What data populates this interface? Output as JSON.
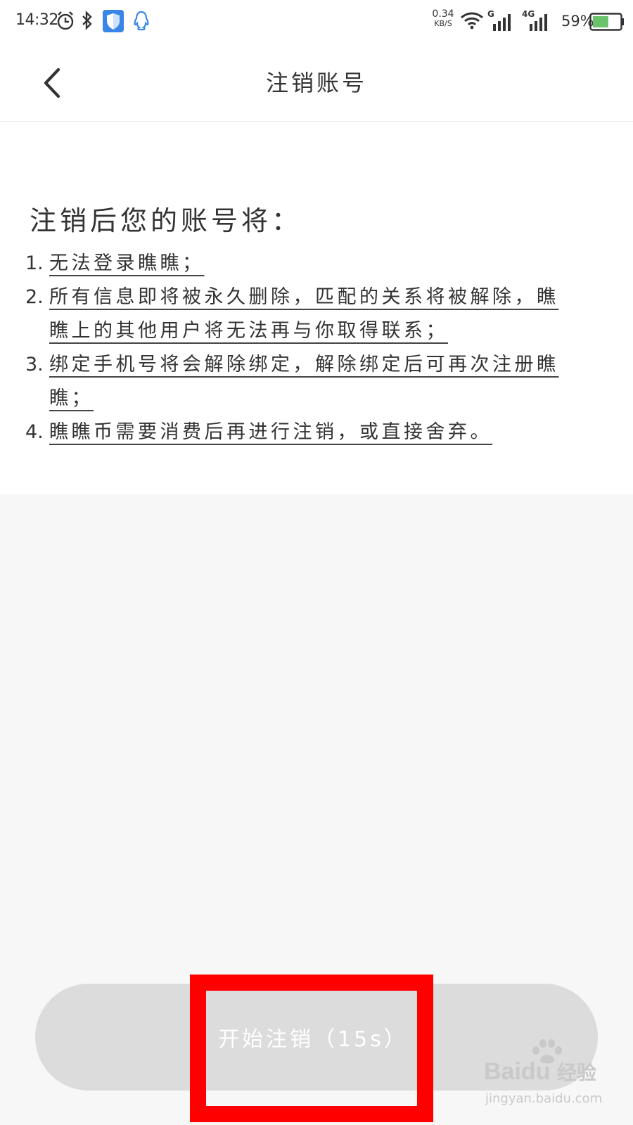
{
  "status_bar": {
    "time": "14:32",
    "net_speed_value": "0.34",
    "net_speed_unit": "KB/S",
    "signal_1_label": "G",
    "signal_2_label": "4G",
    "battery_pct": "59%",
    "icons": [
      "alarm-icon",
      "bluetooth-icon",
      "shield-icon",
      "qq-icon",
      "wifi-icon",
      "signal-icon",
      "battery-icon"
    ]
  },
  "header": {
    "title": "注销账号"
  },
  "content": {
    "heading": "注销后您的账号将：",
    "items": [
      {
        "num": "1.",
        "text": "无法登录瞧瞧；"
      },
      {
        "num": "2.",
        "text": "所有信息即将被永久删除，匹配的关系将被解除，瞧瞧上的其他用户将无法再与你取得联系；"
      },
      {
        "num": "3.",
        "text": "绑定手机号将会解除绑定，解除绑定后可再次注册瞧瞧；"
      },
      {
        "num": "4.",
        "text": "瞧瞧币需要消费后再进行注销，或直接舍弃。"
      }
    ]
  },
  "action": {
    "button_label": "开始注销（15s）"
  },
  "colors": {
    "button_bg": "#dcdcdc",
    "highlight": "#ff0000",
    "battery_fill": "#6ac26a",
    "shield_bg": "#3a86e8",
    "watermark": "#c9c9c9"
  },
  "watermark": {
    "brand_left": "Bai",
    "brand_right": "du",
    "brand_cn": "经验",
    "url": "jingyan.baidu.com"
  }
}
